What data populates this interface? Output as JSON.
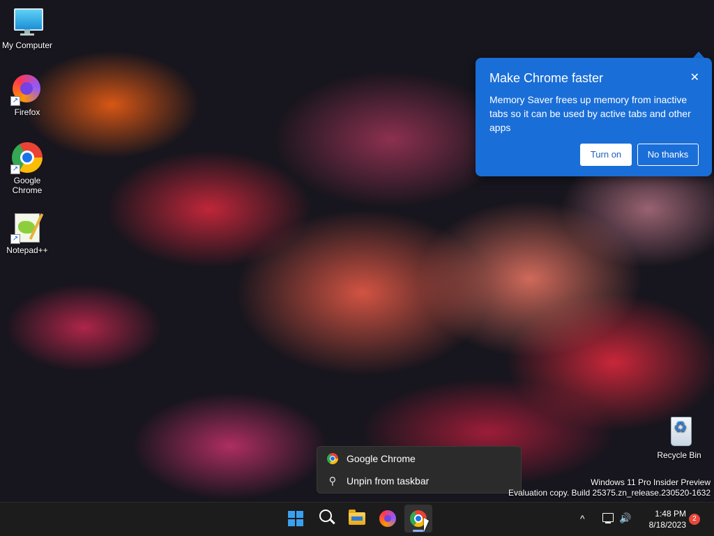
{
  "desktop": {
    "icons": [
      {
        "label": "My Computer",
        "icon": "my-computer-icon"
      },
      {
        "label": "Firefox",
        "icon": "firefox-icon"
      },
      {
        "label": "Google Chrome",
        "icon": "chrome-icon"
      },
      {
        "label": "Notepad++",
        "icon": "notepad-plus-plus-icon"
      },
      {
        "label": "Recycle Bin",
        "icon": "recycle-bin-icon"
      }
    ],
    "shortcut_glyph": "↗",
    "watermark": {
      "line1": "Windows 11 Pro Insider Preview",
      "line2": "Evaluation copy. Build 25375.zn_release.230520-1632"
    }
  },
  "popup": {
    "title": "Make Chrome faster",
    "body": "Memory Saver frees up memory from inactive tabs so it can be used by active tabs and other apps",
    "close_glyph": "✕",
    "turn_on_label": "Turn on",
    "no_thanks_label": "No thanks",
    "background_color": "#1a6ed8"
  },
  "context_menu": {
    "items": [
      {
        "label": "Google Chrome",
        "icon": "chrome-icon"
      },
      {
        "label": "Unpin from taskbar",
        "icon": "unpin-icon"
      }
    ],
    "unpin_glyph": "⚲"
  },
  "taskbar": {
    "apps": [
      "start",
      "search",
      "file-explorer",
      "firefox",
      "chrome"
    ],
    "active_app": "chrome",
    "tray": {
      "chevron": "^",
      "volume_glyph": "🔊",
      "time": "1:48 PM",
      "date": "8/18/2023",
      "notification_count": "2"
    }
  }
}
